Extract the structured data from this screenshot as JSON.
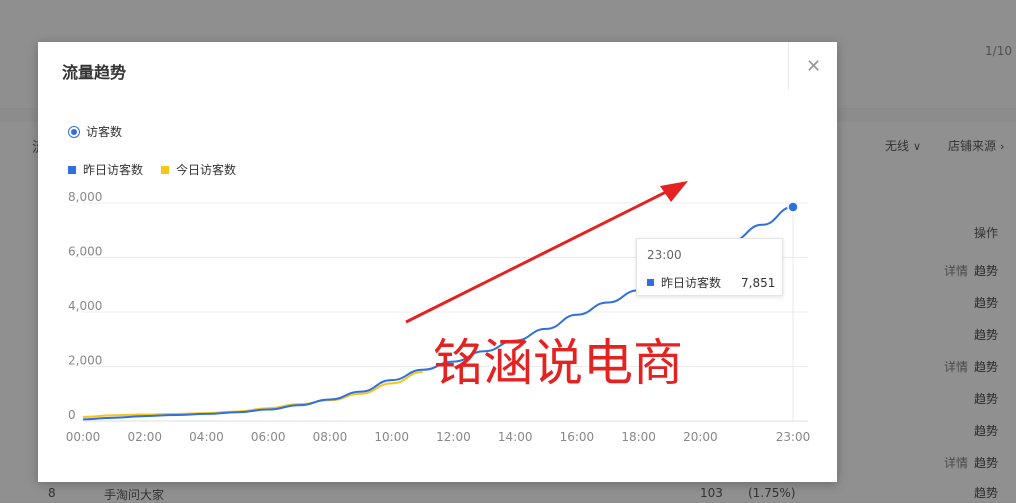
{
  "background": {
    "pager": "1/10",
    "tab_fragment": "流",
    "filters": [
      {
        "label": "无线",
        "chevron": "∨"
      },
      {
        "label": "店铺来源",
        "chevron": "›"
      }
    ],
    "table_header_operation": "操作",
    "row_actions": [
      {
        "detail": "详情",
        "trend": "趋势"
      },
      {
        "detail": "",
        "trend": "趋势"
      },
      {
        "detail": "",
        "trend": "趋势"
      },
      {
        "detail": "详情",
        "trend": "趋势"
      },
      {
        "detail": "",
        "trend": "趋势"
      },
      {
        "detail": "",
        "trend": "趋势"
      },
      {
        "detail": "详情",
        "trend": "趋势"
      },
      {
        "detail": "",
        "trend": "趋势"
      }
    ],
    "bottom_row": {
      "rank": "8",
      "name": "手淘问大家",
      "value": "103",
      "percent": "(1.75%)"
    }
  },
  "modal": {
    "title": "流量趋势",
    "close_icon": "close-icon",
    "metric_radio": {
      "label": "访客数",
      "selected": true
    },
    "legend": [
      {
        "label": "昨日访客数",
        "color": "#2f6fde"
      },
      {
        "label": "今日访客数",
        "color": "#f5c518"
      }
    ],
    "tooltip": {
      "time": "23:00",
      "series": "昨日访客数",
      "value": "7,851"
    },
    "watermark": "铭涵说电商"
  },
  "chart_data": {
    "type": "line",
    "title": "",
    "xlabel": "",
    "ylabel": "",
    "ylim": [
      0,
      8000
    ],
    "yticks": [
      "0",
      "2,000",
      "4,000",
      "6,000",
      "8,000"
    ],
    "xticks": [
      "00:00",
      "02:00",
      "04:00",
      "06:00",
      "08:00",
      "10:00",
      "12:00",
      "14:00",
      "16:00",
      "18:00",
      "20:00",
      "23:00"
    ],
    "grid": true,
    "legend_position": "top-left",
    "series": [
      {
        "name": "昨日访客数",
        "color": "#2f6fde",
        "x": [
          "00:00",
          "01:00",
          "02:00",
          "03:00",
          "04:00",
          "05:00",
          "06:00",
          "07:00",
          "08:00",
          "09:00",
          "10:00",
          "11:00",
          "12:00",
          "13:00",
          "14:00",
          "15:00",
          "16:00",
          "17:00",
          "18:00",
          "19:00",
          "20:00",
          "21:00",
          "22:00",
          "23:00"
        ],
        "values": [
          60,
          120,
          180,
          220,
          260,
          320,
          420,
          580,
          790,
          1080,
          1500,
          1880,
          2180,
          2560,
          2950,
          3380,
          3900,
          4350,
          4800,
          5250,
          5750,
          6600,
          7200,
          7851
        ]
      },
      {
        "name": "今日访客数",
        "color": "#f5c518",
        "x": [
          "00:00",
          "01:00",
          "02:00",
          "03:00",
          "04:00",
          "05:00",
          "06:00",
          "07:00",
          "08:00",
          "09:00",
          "10:00",
          "11:00"
        ],
        "values": [
          150,
          210,
          240,
          260,
          290,
          350,
          470,
          620,
          760,
          1000,
          1380,
          1800
        ]
      }
    ]
  }
}
